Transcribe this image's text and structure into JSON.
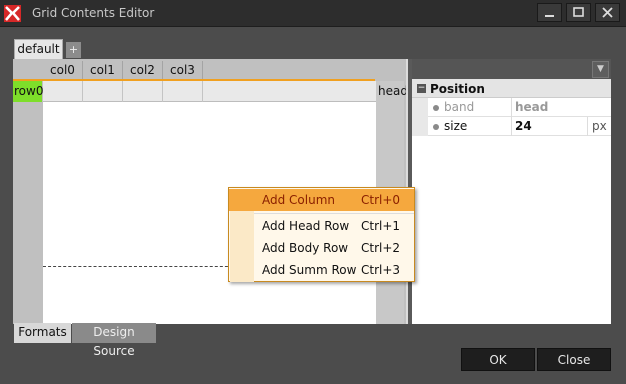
{
  "window": {
    "title": "Grid Contents Editor",
    "controls": {
      "minimize": "—",
      "maximize": "☐",
      "close": "✕"
    }
  },
  "top_tabs": [
    {
      "label": "default",
      "active": true
    },
    {
      "label": "+"
    }
  ],
  "grid": {
    "columns": [
      "col0",
      "col1",
      "col2",
      "col3"
    ],
    "rows": [
      "row0"
    ],
    "band_label": "head"
  },
  "bottom_tabs": [
    {
      "label": "Formats",
      "active": true
    },
    {
      "label": "Design Source"
    }
  ],
  "properties": {
    "group": "Position",
    "group_toggle": "−",
    "items": [
      {
        "name": "band",
        "value": "head",
        "unit": ""
      },
      {
        "name": "size",
        "value": "24",
        "unit": "px"
      }
    ]
  },
  "context_menu": {
    "items": [
      {
        "label": "Add Column",
        "shortcut": "Ctrl+0"
      },
      {
        "label": "Add Head Row",
        "shortcut": "Ctrl+1"
      },
      {
        "label": "Add Body Row",
        "shortcut": "Ctrl+2"
      },
      {
        "label": "Add Summ Row",
        "shortcut": "Ctrl+3"
      }
    ]
  },
  "buttons": {
    "ok": "OK",
    "close": "Close"
  },
  "colors": {
    "accent": "#f5a83e",
    "row_header": "#7ede2a",
    "app_icon": "#d62828"
  }
}
